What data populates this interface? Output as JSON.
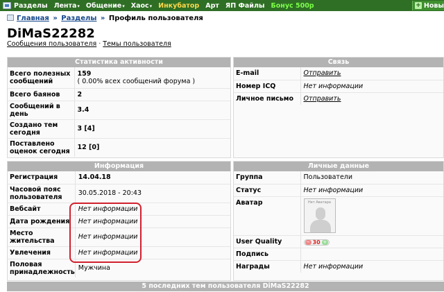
{
  "nav": {
    "items": [
      {
        "label": "Разделы",
        "arrow": ""
      },
      {
        "label": "Лента",
        "arrow": "▾"
      },
      {
        "label": "Общение",
        "arrow": "▾"
      },
      {
        "label": "Хаос",
        "arrow": "▾"
      },
      {
        "label": "Инкубатор",
        "arrow": ""
      },
      {
        "label": "Арт",
        "arrow": ""
      },
      {
        "label": "ЯП Файлы",
        "arrow": ""
      },
      {
        "label": "Бонус 500р",
        "arrow": ""
      }
    ],
    "new_button": "Новы"
  },
  "breadcrumb": {
    "home": "Главная",
    "sep1": "»",
    "sections": "Разделы",
    "sep2": "»",
    "current": "Профиль пользователя"
  },
  "title": "DiMaS22282",
  "subnav": {
    "messages": "Сообщения пользователя",
    "sep": "·",
    "topics": "Темы пользователя"
  },
  "stats": {
    "header": "Статистика активности",
    "total_posts_label": "Всего полезных сообщений",
    "total_posts_value": "159",
    "total_posts_note": "( 0.00% всех сообщений форума )",
    "bans_label": "Всего баянов",
    "bans_value": "2",
    "per_day_label": "Сообщений в день",
    "per_day_value": "3.4",
    "topics_today_label": "Создано тем сегодня",
    "topics_today_value": "3 [4]",
    "ratings_today_label": "Поставлено оценок сегодня",
    "ratings_today_value": "12 [0]"
  },
  "contact": {
    "header": "Связь",
    "email_label": "E-mail",
    "email_value": "Отправить",
    "icq_label": "Номер ICQ",
    "icq_value": "Нет информации",
    "pm_label": "Личное письмо",
    "pm_value": "Отправить"
  },
  "info": {
    "header": "Информация",
    "reg_label": "Регистрация",
    "reg_value": "14.04.18",
    "tz_label": "Часовой пояс пользователя",
    "tz_value": "30.05.2018 - 20:43",
    "website_label": "Вебсайт",
    "website_value": "Нет информации",
    "birth_label": "Дата рождения",
    "birth_value": "Нет информации",
    "location_label": "Место жительства",
    "location_value": "Нет информации",
    "hobby_label": "Увлечения",
    "hobby_value": "Нет информации",
    "gender_label": "Половая принадлежность",
    "gender_value": "Мужчина"
  },
  "personal": {
    "header": "Личные данные",
    "group_label": "Группа",
    "group_value": "Пользователи",
    "status_label": "Статус",
    "status_value": "Нет информации",
    "avatar_label": "Аватар",
    "avatar_caption": "Нет Аватара",
    "uq_label": "User Quality",
    "uq_minus": "−",
    "uq_value": "30",
    "uq_plus": "+",
    "signature_label": "Подпись",
    "awards_label": "Награды",
    "awards_value": "Нет информации"
  },
  "last_topics": {
    "header": "5 последних тем пользователя DiMaS22282"
  },
  "colors": {
    "nav_bg": "#2f6f25",
    "panel_header": "#b3b3b3",
    "link": "#14468c",
    "highlight": "#d11f2c"
  }
}
